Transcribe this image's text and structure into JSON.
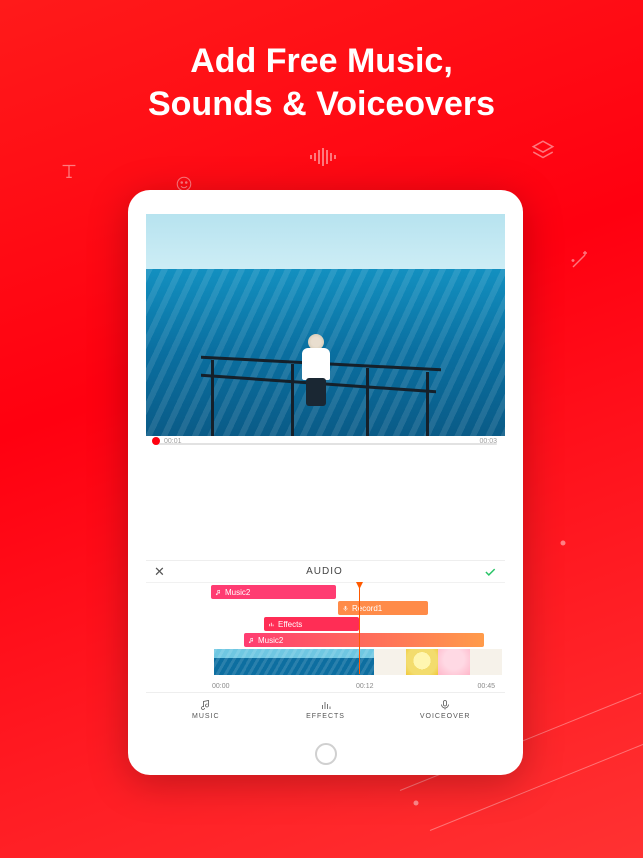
{
  "headline_line1": "Add Free Music,",
  "headline_line2": "Sounds & Voiceovers",
  "progress": {
    "start": "00:01",
    "end": "00:03"
  },
  "panel": {
    "close": "✕",
    "title": "AUDIO",
    "tracks": {
      "music2a": {
        "label": "Music2"
      },
      "record": {
        "label": "Record1"
      },
      "effects": {
        "label": "Effects"
      },
      "music2b": {
        "label": "Music2"
      }
    },
    "ruler": {
      "t0": "00:00",
      "t1": "00:12",
      "t2": "00:45"
    }
  },
  "tabs": {
    "music": "MUSIC",
    "effects": "EFFECTS",
    "voiceover": "VOICEOVER"
  },
  "colors": {
    "accent": "#ff0010",
    "track_pink": "#ff3c72",
    "track_orange": "#ff8b48",
    "track_red": "#ff2d55"
  }
}
